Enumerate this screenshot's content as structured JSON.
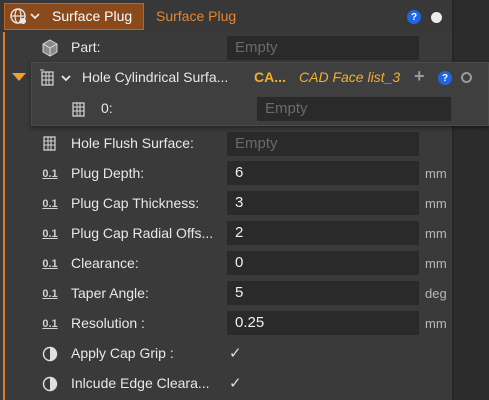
{
  "header": {
    "title": "Surface Plug",
    "subtitle": "Surface Plug",
    "help_glyph": "?"
  },
  "rows": {
    "part": {
      "label": "Part:",
      "value": "Empty"
    },
    "hole_cyl": {
      "label": "Hole Cylindrical Surfa...",
      "type_short": "CA...",
      "value": "CAD Face list_3",
      "help_glyph": "?"
    },
    "hole_cyl_item": {
      "label": "0:",
      "value": "Empty"
    },
    "hole_flush": {
      "label": "Hole Flush Surface:",
      "value": "Empty"
    },
    "plug_depth": {
      "icon_text": "0.1",
      "label": "Plug Depth:",
      "value": "6",
      "unit": "mm"
    },
    "cap_thickness": {
      "icon_text": "0.1",
      "label": "Plug Cap Thickness:",
      "value": "3",
      "unit": "mm"
    },
    "cap_radial": {
      "icon_text": "0.1",
      "label": "Plug Cap Radial Offs...",
      "value": "2",
      "unit": "mm"
    },
    "clearance": {
      "icon_text": "0.1",
      "label": "Clearance:",
      "value": "0",
      "unit": "mm"
    },
    "taper": {
      "icon_text": "0.1",
      "label": "Taper Angle:",
      "value": "5",
      "unit": "deg"
    },
    "resolution": {
      "icon_text": "0.1",
      "label": "Resolution :",
      "value": "0.25",
      "unit": "mm"
    },
    "cap_grip": {
      "label": "Apply Cap Grip :",
      "checked": "✓"
    },
    "edge_clear": {
      "label": "Inlcude Edge Cleara...",
      "checked": "✓"
    }
  },
  "icons": {
    "header": "globe-icon",
    "part": "cube-icon",
    "face": "face-grid-icon",
    "numeric": "numeric-icon",
    "toggle": "half-circle-icon"
  },
  "colors": {
    "accent": "#e07b2a",
    "tab_bg": "#8a4a1c",
    "cad_text": "#f0b030",
    "help": "#1e66e6"
  }
}
